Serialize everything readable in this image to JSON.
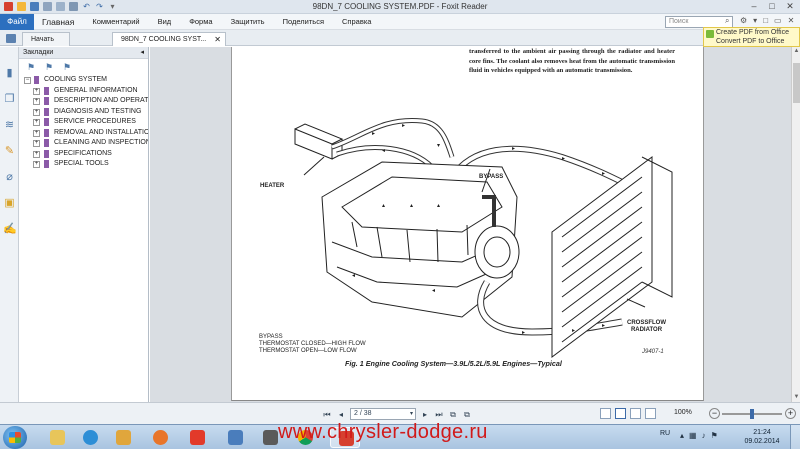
{
  "window": {
    "title": "98DN_7 COOLING SYSTEM.PDF - Foxit Reader"
  },
  "menu": {
    "file": "Файл",
    "items": [
      "Главная",
      "Комментарий",
      "Вид",
      "Форма",
      "Защитить",
      "Поделиться",
      "Справка"
    ],
    "search_placeholder": "Поиск"
  },
  "tabs": {
    "start": "Начать",
    "doc": "98DN_7 COOLING SYST..."
  },
  "promo": {
    "line1": "Create PDF from Office",
    "line2": "Convert PDF to Office"
  },
  "bookmarks": {
    "header": "Закладки",
    "root": "COOLING SYSTEM",
    "items": [
      "GENERAL INFORMATION",
      "DESCRIPTION AND OPERAT",
      "DIAGNOSIS AND TESTING",
      "SERVICE PROCEDURES",
      "REMOVAL AND INSTALLATIO",
      "CLEANING AND INSPECTION",
      "SPECIFICATIONS",
      "SPECIAL TOOLS"
    ]
  },
  "document": {
    "paragraph": "transferred to the ambient air passing through the radiator and heater core fins. The coolant also removes heat from the automatic transmission fluid in vehicles equipped with an automatic transmission.",
    "labels": {
      "heater": "HEATER",
      "bypass": "BYPASS",
      "radiator_line1": "CROSSFLOW",
      "radiator_line2": "RADIATOR",
      "legend1": "BYPASS",
      "legend2": "THERMOSTAT CLOSED—HIGH FLOW",
      "legend3": "THERMOSTAT OPEN—LOW FLOW"
    },
    "caption": "Fig. 1 Engine Cooling System—3.9L/5.2L/5.9L Engines—Typical",
    "fig_number": "J9407-1"
  },
  "navigation": {
    "page_display": "2 / 38",
    "zoom": "100%"
  },
  "taskbar": {
    "watermark": "www.chrysler-dodge.ru",
    "language": "RU",
    "time": "21:24",
    "date": "09.02.2014"
  },
  "colors": {
    "accent": "#2c6fbf",
    "bookmark": "#8b5aa8",
    "watermark": "#d11a1a"
  }
}
